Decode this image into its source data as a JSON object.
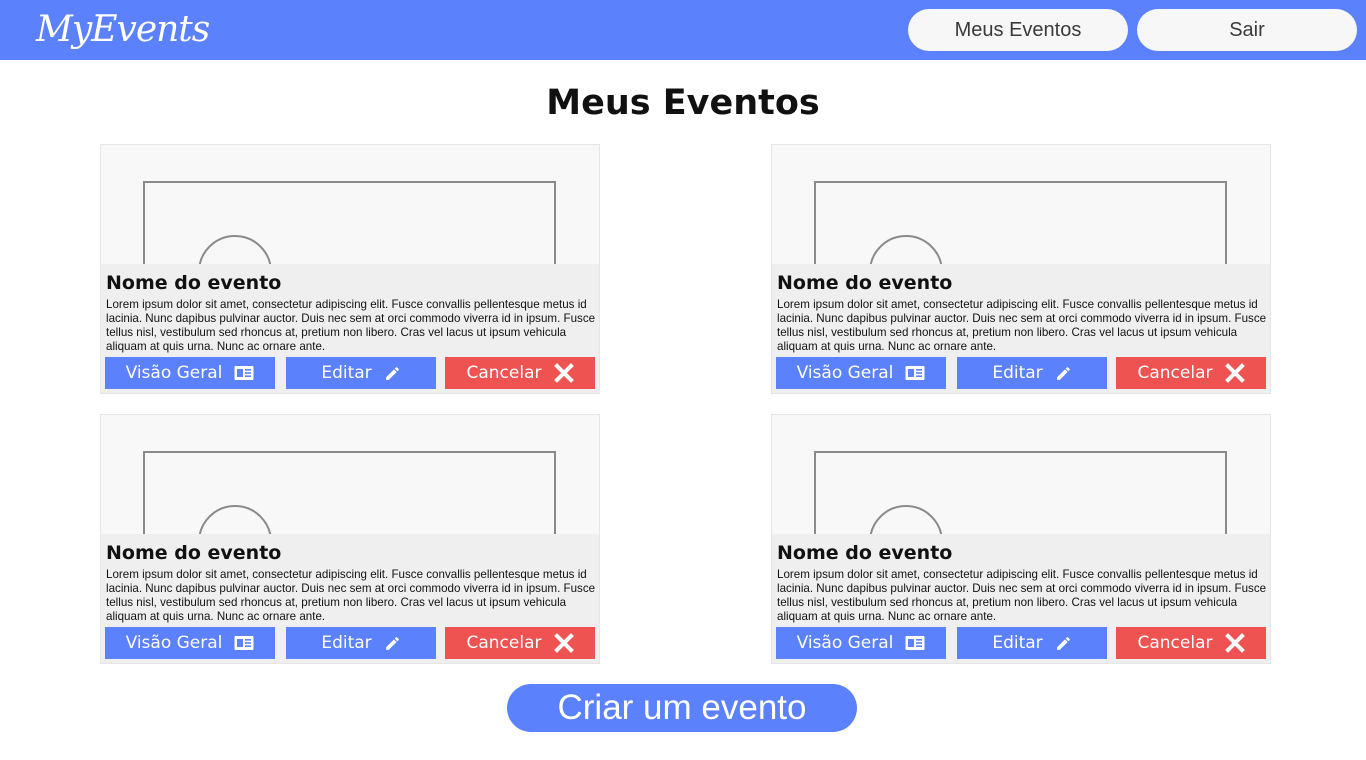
{
  "header": {
    "logo": "MyEvents",
    "nav": {
      "my_events_label": "Meus Eventos",
      "logout_label": "Sair"
    }
  },
  "main": {
    "title": "Meus Eventos",
    "cards": [
      {
        "name": "Nome do evento",
        "description": "Lorem ipsum dolor sit amet, consectetur adipiscing elit. Fusce convallis pellentesque metus id lacinia. Nunc dapibus pulvinar auctor. Duis nec sem at orci commodo viverra id in ipsum. Fusce tellus nisl, vestibulum sed rhoncus at, pretium non libero. Cras vel lacus ut ipsum vehicula aliquam at quis urna. Nunc ac ornare ante.",
        "overview_label": "Visão Geral",
        "edit_label": "Editar",
        "cancel_label": "Cancelar"
      },
      {
        "name": "Nome do evento",
        "description": "Lorem ipsum dolor sit amet, consectetur adipiscing elit. Fusce convallis pellentesque metus id lacinia. Nunc dapibus pulvinar auctor. Duis nec sem at orci commodo viverra id in ipsum. Fusce tellus nisl, vestibulum sed rhoncus at, pretium non libero. Cras vel lacus ut ipsum vehicula aliquam at quis urna. Nunc ac ornare ante.",
        "overview_label": "Visão Geral",
        "edit_label": "Editar",
        "cancel_label": "Cancelar"
      },
      {
        "name": "Nome do evento",
        "description": "Lorem ipsum dolor sit amet, consectetur adipiscing elit. Fusce convallis pellentesque metus id lacinia. Nunc dapibus pulvinar auctor. Duis nec sem at orci commodo viverra id in ipsum. Fusce tellus nisl, vestibulum sed rhoncus at, pretium non libero. Cras vel lacus ut ipsum vehicula aliquam at quis urna. Nunc ac ornare ante.",
        "overview_label": "Visão Geral",
        "edit_label": "Editar",
        "cancel_label": "Cancelar"
      },
      {
        "name": "Nome do evento",
        "description": "Lorem ipsum dolor sit amet, consectetur adipiscing elit. Fusce convallis pellentesque metus id lacinia. Nunc dapibus pulvinar auctor. Duis nec sem at orci commodo viverra id in ipsum. Fusce tellus nisl, vestibulum sed rhoncus at, pretium non libero. Cras vel lacus ut ipsum vehicula aliquam at quis urna. Nunc ac ornare ante.",
        "overview_label": "Visão Geral",
        "edit_label": "Editar",
        "cancel_label": "Cancelar"
      }
    ],
    "create_label": "Criar um evento"
  },
  "icons": {
    "overview": "newspaper-icon",
    "edit": "pencil-icon",
    "cancel": "close-icon",
    "image": "image-placeholder-icon"
  },
  "colors": {
    "primary": "#5b81fc",
    "danger": "#ee5352",
    "card_background": "#efefef",
    "nav_button": "#f7f7f7"
  }
}
